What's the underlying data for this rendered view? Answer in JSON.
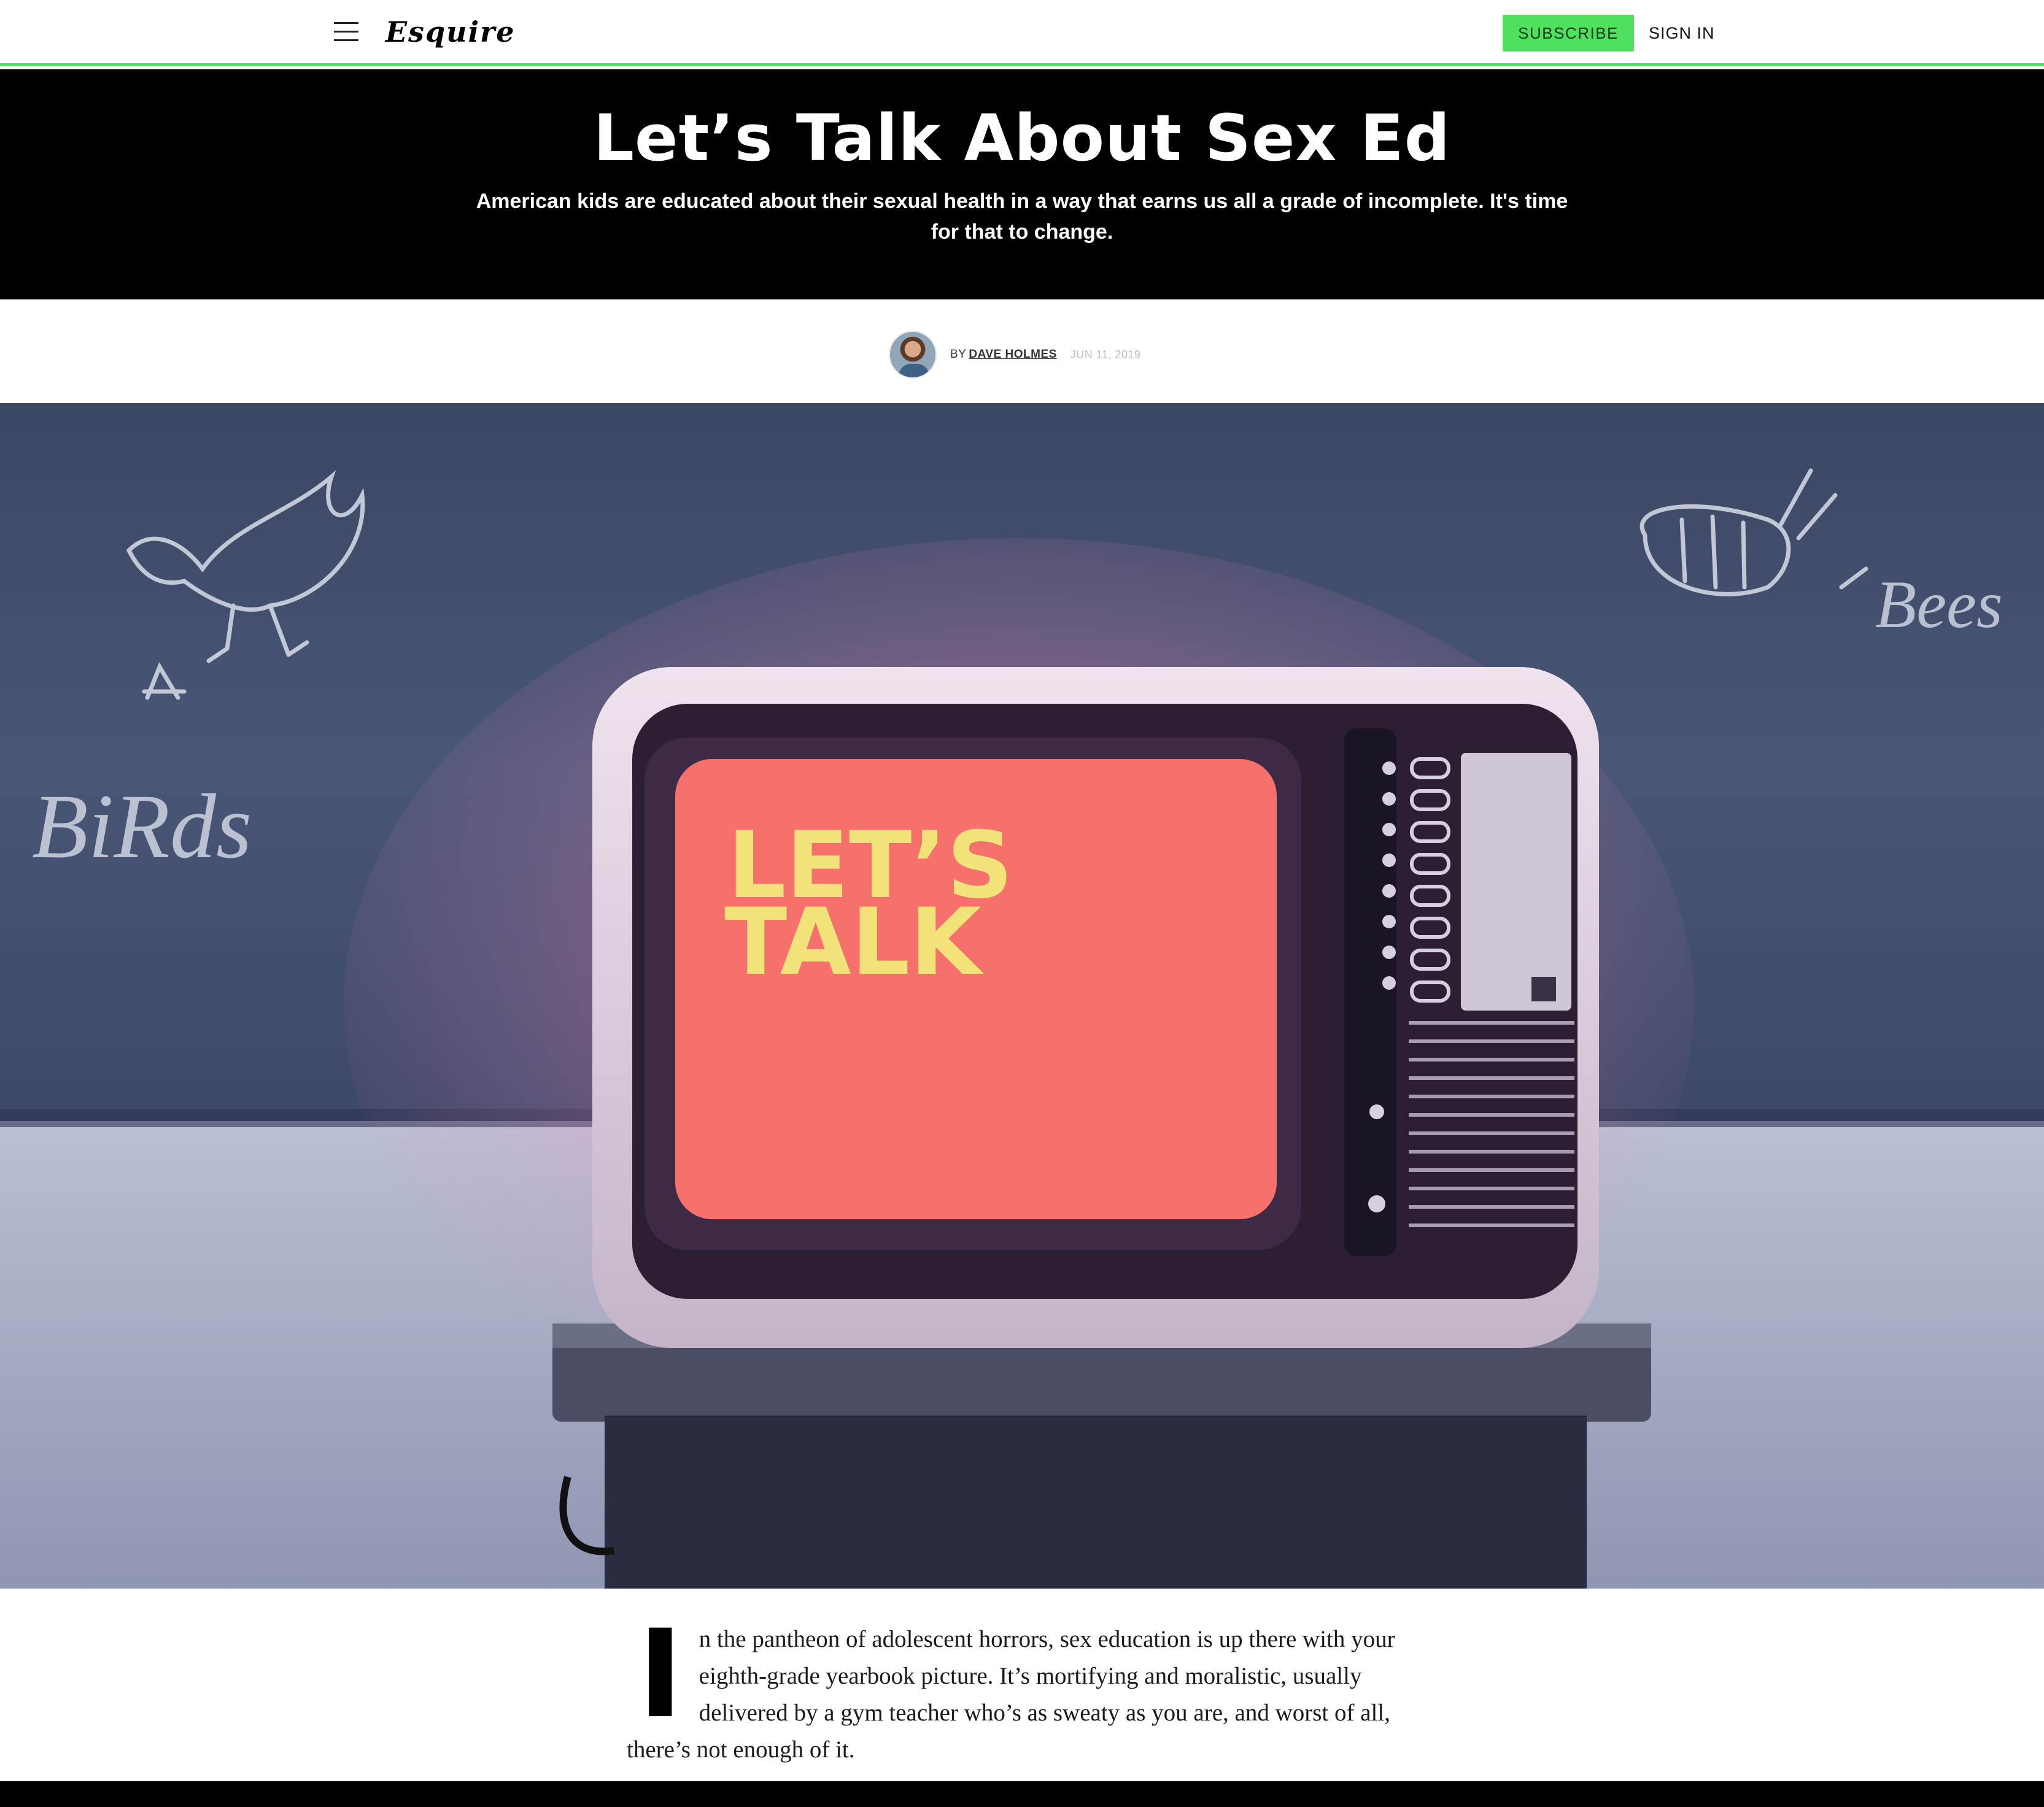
{
  "nav": {
    "logo": "Esquire",
    "subscribe_label": "SUBSCRIBE",
    "signin_label": "SIGN IN",
    "menu_icon": "hamburger-menu-icon"
  },
  "article": {
    "title": "Let’s Talk About Sex Ed",
    "dek": "American kids are educated about their sexual health in a way that earns us all a grade of incomplete. It's time for that to change.",
    "byline_prefix": "BY",
    "author": "DAVE HOLMES",
    "date": "JUN 11, 2019",
    "lead_image": {
      "chalk_left": "BiRds",
      "chalk_right": "Bees",
      "screen_line1": "LET’S",
      "screen_line2": "TALK"
    },
    "dropcap": "I",
    "first_paragraph": "n the pantheon of adolescent horrors, sex education is up there with your eighth-grade yearbook picture. It’s mortifying and moralistic, usually delivered by a gym teacher who’s as sweaty as you are, and worst of all, there’s not enough of it."
  },
  "colors": {
    "accent_green": "#4fe060",
    "hero_bg": "#000000",
    "screen_red": "#f6706c",
    "screen_text": "#f2e27a"
  }
}
